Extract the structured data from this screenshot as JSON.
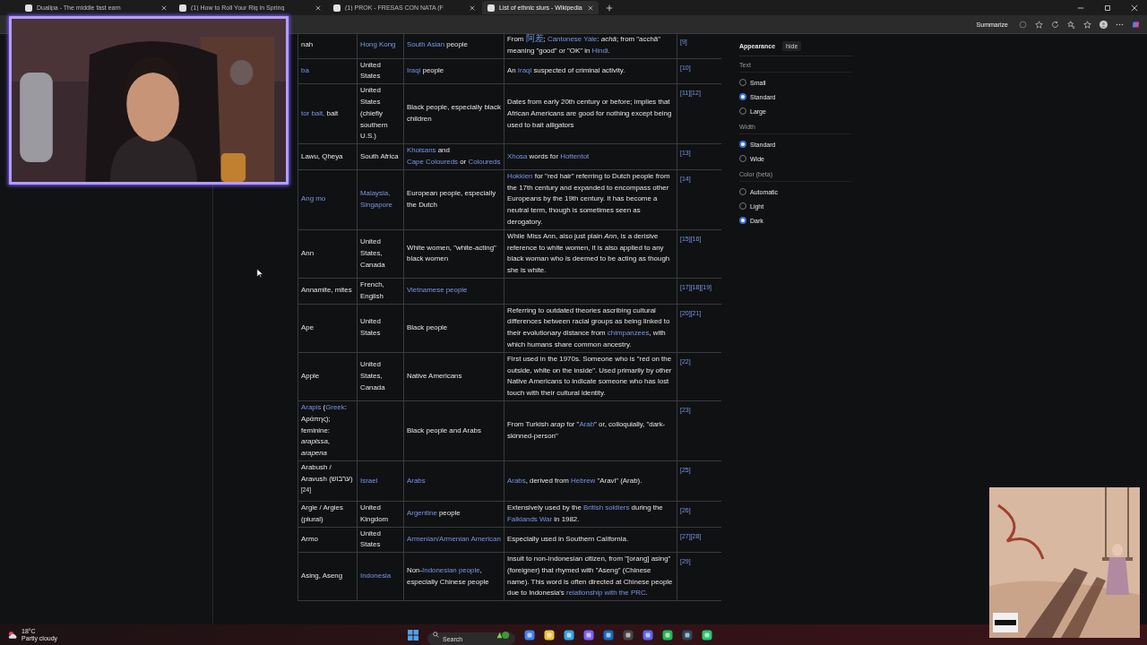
{
  "browser": {
    "tabs": [
      {
        "title": "Dualipa - The middle fast earn",
        "selected": false
      },
      {
        "title": "(1) How to Roll Your Rig in Spring",
        "selected": false
      },
      {
        "title": "(1) PROK - FRESAS CON NATA (F",
        "selected": false
      },
      {
        "title": "List of ethnic slurs - Wikipedia",
        "selected": true
      }
    ],
    "summarize_button": "Summarize"
  },
  "table": {
    "rows": [
      {
        "term": "nah",
        "origin": [
          {
            "link": "Hong Kong"
          }
        ],
        "targets": [
          {
            "link": "South Asian"
          },
          " people"
        ],
        "meaning": [
          "From ",
          {
            "link": "阿差",
            "kind": "cjk"
          },
          "; ",
          {
            "link": "Cantonese Yale"
          },
          ": *achā*; from \"acchā\" meaning \"good\" or \"OK\" in ",
          {
            "link": "Hindi"
          },
          "."
        ],
        "refs": "[9]"
      },
      {
        "term": [
          {
            "link": "ba"
          }
        ],
        "origin": "United States",
        "targets": [
          {
            "link": "Iraqi"
          },
          " people"
        ],
        "meaning": [
          "An ",
          {
            "link": "Iraqi"
          },
          " suspected of criminal activity."
        ],
        "refs": "[10]"
      },
      {
        "term": [
          {
            "link": "tor bait,"
          },
          " bait"
        ],
        "origin": "United States (chiefly southern U.S.)",
        "targets": "Black people, especially black children",
        "meaning": "Dates from early 20th century or before; implies that African Americans are good for nothing except being used to bait alligators",
        "refs": "[11][12]"
      },
      {
        "term": "Lawu, Qheya",
        "origin": "South Africa",
        "targets": [
          {
            "link": "Khoisans"
          },
          " and ",
          {
            "link": "Cape Coloureds"
          },
          " or ",
          {
            "link": "Coloureds"
          }
        ],
        "meaning": [
          {
            "link": "Xhosa"
          },
          " words for ",
          {
            "link": "Hottentot"
          }
        ],
        "refs": "[13]"
      },
      {
        "term": [
          {
            "link": "Ang mo"
          }
        ],
        "origin": [
          {
            "link": "Malaysia,"
          },
          {
            "link": "Singapore"
          }
        ],
        "targets": "European people, especially the Dutch",
        "meaning": [
          {
            "link": "Hokkien"
          },
          " for \"red hair\" referring to Dutch people from the 17th century and expanded to encompass other Europeans by the 19th century. It has become a neutral term, though is sometimes seen as derogatory."
        ],
        "refs": "[14]"
      },
      {
        "term": "Ann",
        "origin": "United States, Canada",
        "targets": "White women, \"white-acting\" black women",
        "meaning": "While Miss Ann, also just plain *Ann*, is a derisive reference to white women, it is also applied to any black woman who is deemed to be acting as though she is white.",
        "refs": "[15][16]"
      },
      {
        "term": "Annamite, mites",
        "origin": "French, English",
        "targets": [
          {
            "link": "Vietnamese people"
          }
        ],
        "refs": "[17][18][19]"
      },
      {
        "term": "Ape",
        "origin": "United States",
        "targets": "Black people",
        "meaning": [
          "Referring to outdated theories ascribing cultural differences between racial groups as being linked to their evolutionary distance from ",
          {
            "link": "chimpanzees"
          },
          ", with which humans share common ancestry."
        ],
        "refs": "[20][21]"
      },
      {
        "term": "Apple",
        "origin": "United States, Canada",
        "targets": "Native Americans",
        "meaning": "First used in the 1970s. Someone who is \"red on the outside, white on the inside\". Used primarily by other Native Americans to indicate someone who has lost touch with their cultural identity.",
        "refs": "[22]"
      },
      {
        "term": [
          {
            "link": "Arapis"
          },
          " (",
          {
            "link": "Greek"
          },
          ": Αράπης); feminine: *arapissa*, *arapena*"
        ],
        "targets": "Black people and Arabs",
        "meaning": [
          "From Turkish *arap* for \"",
          {
            "link": "Arab"
          },
          "\" or, colloquially, \"dark-skinned-person\""
        ],
        "refs": "[23]"
      },
      {
        "term": "Arabush / Aravush (ערבוש)$^{[24]}$",
        "origin": [
          {
            "link": "Israel"
          }
        ],
        "targets": [
          {
            "link": "Arabs"
          }
        ],
        "meaning": [
          {
            "link": "Arabs"
          },
          ", derived from ",
          {
            "link": "Hebrew"
          },
          " \"Aravi\" (Arab)."
        ],
        "refs": "[25]"
      },
      {
        "term": "Argie / Argies (plural)",
        "origin": "United Kingdom",
        "targets": [
          {
            "link": "Argentine"
          },
          " people"
        ],
        "meaning": [
          "Extensively used by the ",
          {
            "link": "British soldiers"
          },
          " during the ",
          {
            "link": "Falklands War"
          },
          " in 1982."
        ],
        "refs": "[26]"
      },
      {
        "term": "Armo",
        "origin": "United States",
        "targets": [
          {
            "link": "Armenian/Armenian American"
          }
        ],
        "meaning": "Especially used in Southern California.",
        "refs": "[27][28]"
      },
      {
        "term": "Asing, Aseng",
        "origin": [
          {
            "link": "Indonesia"
          }
        ],
        "targets": [
          "Non-",
          {
            "link": "Indonesian people"
          },
          ", especially Chinese people"
        ],
        "meaning": [
          "Insult to non-Indonesian citizen, from \"[orang] asing\" (foreigner) that rhymed with \"Aseng\" (Chinese name). This word is often directed at Chinese people due to Indonesia's ",
          {
            "link": "relationship with the PRC"
          },
          "."
        ],
        "refs": "[29]"
      }
    ]
  },
  "appearance": {
    "title": "Appearance",
    "hide_button": "hide",
    "groups": [
      {
        "label": "Text",
        "options": [
          {
            "label": "Small",
            "selected": false
          },
          {
            "label": "Standard",
            "selected": true
          },
          {
            "label": "Large",
            "selected": false
          }
        ]
      },
      {
        "label": "Width",
        "options": [
          {
            "label": "Standard",
            "selected": true
          },
          {
            "label": "Wide",
            "selected": false
          }
        ]
      },
      {
        "label": "Color (beta)",
        "options": [
          {
            "label": "Automatic",
            "selected": false
          },
          {
            "label": "Light",
            "selected": false
          },
          {
            "label": "Dark",
            "selected": true
          }
        ]
      }
    ]
  },
  "taskbar": {
    "weather": {
      "temperature": "18°C",
      "condition": "Partly cloudy"
    },
    "search": {
      "placeholder": "Search"
    }
  }
}
